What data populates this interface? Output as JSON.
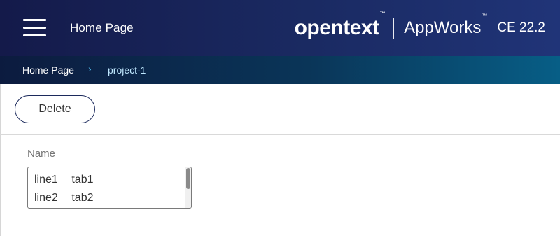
{
  "header": {
    "menu_icon": "hamburger-menu-icon",
    "title": "Home Page",
    "brand": {
      "logo": "opentext",
      "tm": "™",
      "product": "AppWorks",
      "product_tm": "™",
      "version": "CE 22.2"
    }
  },
  "breadcrumb": {
    "items": [
      "Home Page",
      "project-1"
    ],
    "separator": "›"
  },
  "toolbar": {
    "delete_label": "Delete"
  },
  "form": {
    "name_label": "Name",
    "name_lines": [
      "line1\ttab1",
      "line2\ttab2"
    ]
  },
  "colors": {
    "header_dark": "#141a4a",
    "breadcrumb_accent": "#075e86",
    "chevron": "#4fb8e8",
    "button_border": "#1c2a5c"
  }
}
